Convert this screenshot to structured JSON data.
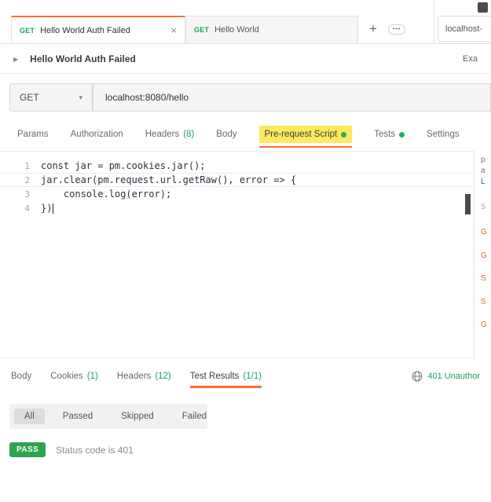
{
  "colors": {
    "accent_orange": "#ff6c37",
    "green": "#18a15f",
    "highlight_yellow": "#ffe95e",
    "pass_green": "#2da44e"
  },
  "icons": {
    "close": "×",
    "add": "+",
    "more": "•••",
    "chevron_right": "▶",
    "caret_down": "▾"
  },
  "tab_bar": {
    "tabs": [
      {
        "method": "GET",
        "title": "Hello World Auth Failed"
      },
      {
        "method": "GET",
        "title": "Hello World"
      }
    ],
    "environment": "localhost-"
  },
  "request_header": {
    "title": "Hello World Auth Failed",
    "examples_label": "Exa"
  },
  "url_bar": {
    "method": "GET",
    "url": "localhost:8080/hello"
  },
  "request_tabs": [
    {
      "label": "Params"
    },
    {
      "label": "Authorization"
    },
    {
      "label": "Headers",
      "count": "(8)"
    },
    {
      "label": "Body"
    },
    {
      "label": "Pre-request Script"
    },
    {
      "label": "Tests"
    },
    {
      "label": "Settings"
    }
  ],
  "editor": {
    "lines": [
      {
        "num": "1",
        "code": "const jar = pm.cookies.jar();"
      },
      {
        "num": "2",
        "code": "jar.clear(pm.request.url.getRaw(), error => {"
      },
      {
        "num": "3",
        "code": "    console.log(error);"
      },
      {
        "num": "4",
        "code": "})"
      }
    ]
  },
  "snippets": {
    "fragments": [
      {
        "text": "p"
      },
      {
        "text": "a"
      },
      {
        "text": "L"
      },
      {
        "text": "S"
      },
      {
        "text": "G"
      },
      {
        "text": "G"
      },
      {
        "text": "S"
      },
      {
        "text": "S"
      },
      {
        "text": "G"
      }
    ]
  },
  "response": {
    "tabs": [
      {
        "label": "Body"
      },
      {
        "label": "Cookies",
        "count": "(1)"
      },
      {
        "label": "Headers",
        "count": "(12)"
      },
      {
        "label": "Test Results",
        "count": "(1/1)"
      }
    ],
    "status": "401 Unauthor",
    "filters": [
      "All",
      "Passed",
      "Skipped",
      "Failed"
    ],
    "result": {
      "badge": "PASS",
      "text": "Status code is 401"
    }
  }
}
